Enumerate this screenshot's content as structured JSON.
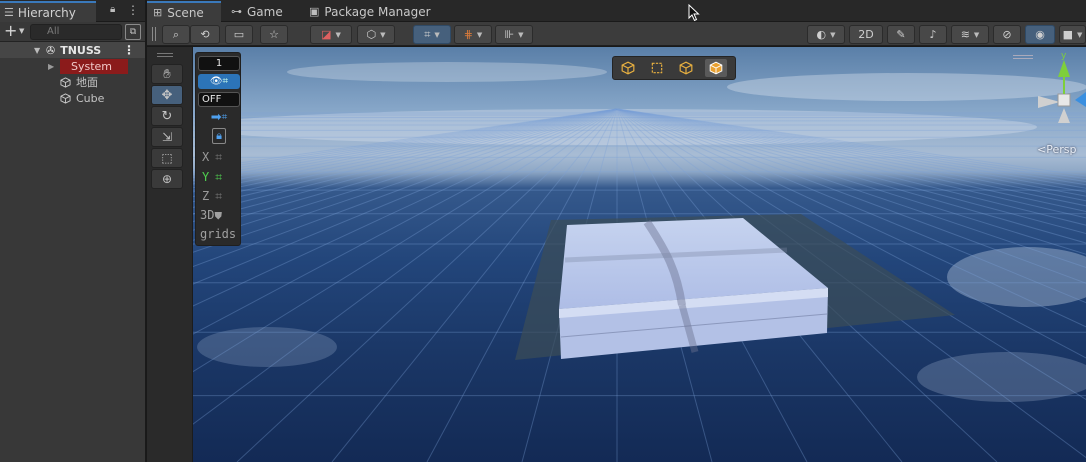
{
  "hierarchy": {
    "tab_label": "Hierarchy",
    "tab_icon": "list-icon",
    "add_label": "+",
    "search_placeholder": "All",
    "scene_name": "TNUSS",
    "items": [
      {
        "label": "System",
        "state": "missing-prefab"
      },
      {
        "label": "地面",
        "icon": "gameobject-icon"
      },
      {
        "label": "Cube",
        "icon": "gameobject-icon"
      }
    ]
  },
  "tabs": [
    {
      "label": "Scene",
      "icon": "grid-icon",
      "active": true
    },
    {
      "label": "Game",
      "icon": "gamepad-icon",
      "active": false
    },
    {
      "label": "Package Manager",
      "icon": "package-icon",
      "active": false
    }
  ],
  "scene_toolbar": {
    "mode_2d_label": "2D"
  },
  "snap_panel": {
    "increment_value": "1",
    "snap_state": "OFF",
    "axis_x": "X",
    "axis_y": "Y",
    "axis_z": "Z",
    "label_3d": "3D",
    "label_grids": "grids"
  },
  "gizmo": {
    "projection_label": "Persp",
    "axis_y": "y"
  },
  "colors": {
    "accent": "#3a79bb",
    "active_button": "#46607c",
    "error_row": "#8b1b1b",
    "axis_y": "#4fcf4f"
  }
}
